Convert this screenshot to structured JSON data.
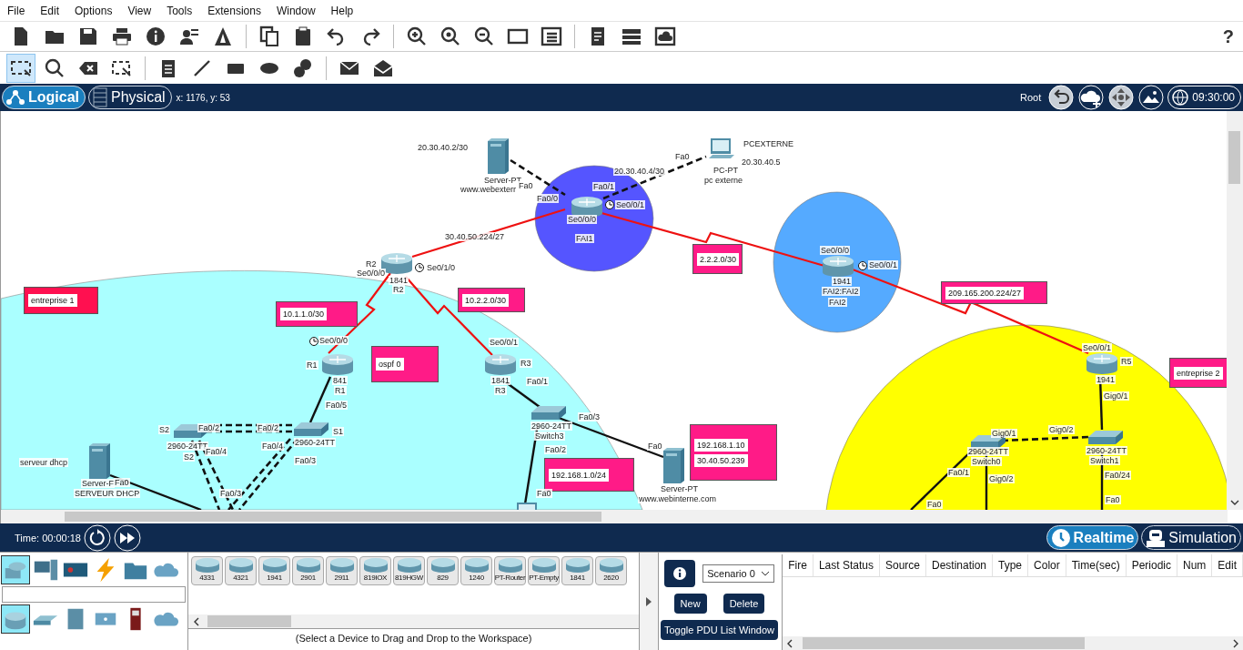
{
  "menu": [
    "File",
    "Edit",
    "Options",
    "View",
    "Tools",
    "Extensions",
    "Window",
    "Help"
  ],
  "help_glyph": "?",
  "workspace_tabs": [
    {
      "label": "Logical",
      "selected": true
    },
    {
      "label": "Physical",
      "selected": false
    }
  ],
  "cursor_position": "x: 1176, y: 53",
  "root_label": "Root",
  "clock": "09:30:00",
  "canvas": {
    "zones": [
      {
        "color": "#aaffff"
      },
      {
        "color": "#5555ff"
      },
      {
        "color": "#55aaff"
      },
      {
        "color": "#ffff00"
      }
    ],
    "notes": [
      {
        "color": "#ff1050",
        "lines": [
          "entreprise 1"
        ]
      },
      {
        "color": "#ff1b87",
        "lines": [
          "10.1.1.0/30"
        ]
      },
      {
        "color": "#ff1b87",
        "lines": [
          "10.2.2.0/30"
        ]
      },
      {
        "color": "#ff1b87",
        "lines": [
          "ospf 0"
        ]
      },
      {
        "color": "#ff1b87",
        "lines": [
          "2.2.2.0/30"
        ]
      },
      {
        "color": "#ff1b87",
        "lines": [
          "192.168.1.10",
          "30.40.50.239"
        ]
      },
      {
        "color": "#ff1b87",
        "lines": [
          "192.168.1.0/24"
        ]
      },
      {
        "color": "#ff1b87",
        "lines": [
          "209.165.200.224/27"
        ]
      },
      {
        "color": "#ff1b87",
        "lines": [
          "entreprise 2"
        ]
      }
    ],
    "devices": [
      {
        "kind": "server"
      },
      {
        "kind": "pc"
      },
      {
        "kind": "router"
      },
      {
        "kind": "router"
      },
      {
        "kind": "router"
      },
      {
        "kind": "router"
      },
      {
        "kind": "router"
      },
      {
        "kind": "router"
      },
      {
        "kind": "switch"
      },
      {
        "kind": "switch"
      },
      {
        "kind": "switch"
      },
      {
        "kind": "switch"
      },
      {
        "kind": "switch"
      },
      {
        "kind": "server"
      },
      {
        "kind": "server"
      },
      {
        "kind": "pc"
      }
    ],
    "labels": [
      "20.30.40.2/30",
      "Server-PT",
      "www.webexterr",
      "Fa0",
      "Fa0/0",
      "20.30.40.4/30",
      "Fa0",
      "PCEXTERNE",
      "20.30.40.5",
      "PC-PT",
      "pc externe",
      "Fa0/1",
      "Se0/0/1",
      "Se0/0/0",
      "FAI1",
      "30.40.50.224/27",
      "R2",
      "Se0/0/0",
      "Se0/1/0",
      "1841",
      "R2",
      "Se0/0/0",
      "Se0/0/1",
      "1941",
      "FAI2:FAI2",
      "FAI2",
      "Se0/0/0",
      "R1",
      "841",
      "R1",
      "Fa0/5",
      "Se0/0/1",
      "R3",
      "1841",
      "R3",
      "Fa0/1",
      "2960-24TT",
      "Switch3",
      "Fa0/3",
      "Fa0/2",
      "Fa0",
      "Server-PT",
      "www.webinterne.com",
      "Fa0",
      "S2",
      "Fa0/2",
      "2960-24TT",
      "S2",
      "Fa0/4",
      "Fa0/2",
      "S1",
      "Fa0/4",
      "2960-24TT",
      "Fa0/3",
      "Fa0/3",
      "serveur dhcp",
      "Server-F",
      "Fa0",
      "SERVEUR DHCP",
      "Se0/0/1",
      "R5",
      "1941",
      "Gig0/1",
      "Gig0/1",
      "Gig0/2",
      "2960-24TT",
      "Switch0",
      "Fa0/1",
      "Gig0/2",
      "2960-24TT",
      "Switch1",
      "Fa0/24",
      "Fa0",
      "Fa0"
    ]
  },
  "time": "Time: 00:00:18",
  "mode_tabs": [
    {
      "label": "Realtime",
      "selected": true
    },
    {
      "label": "Simulation",
      "selected": false
    }
  ],
  "device_categories": [
    {
      "kind": "network",
      "selected": true
    },
    {
      "kind": "end-device",
      "selected": false
    },
    {
      "kind": "component",
      "selected": false
    },
    {
      "kind": "connection",
      "selected": false
    },
    {
      "kind": "folder",
      "selected": false
    },
    {
      "kind": "cloud",
      "selected": false
    }
  ],
  "device_types": [
    {
      "kind": "router",
      "selected": true
    },
    {
      "kind": "switch",
      "selected": false
    },
    {
      "kind": "hub",
      "selected": false
    },
    {
      "kind": "wireless",
      "selected": false
    },
    {
      "kind": "security",
      "selected": false
    },
    {
      "kind": "wan",
      "selected": false
    }
  ],
  "models": [
    "4331",
    "4321",
    "1941",
    "2901",
    "2911",
    "819IOX",
    "819HGW",
    "829",
    "1240",
    "PT-Router",
    "PT-Empty",
    "1841",
    "2620"
  ],
  "hint": "(Select a Device to Drag and Drop to the Workspace)",
  "scenario": "Scenario 0",
  "buttons": [
    "New",
    "Delete"
  ],
  "toggle_button": "Toggle PDU List Window",
  "pdu_columns": [
    "Fire",
    "Last Status",
    "Source",
    "Destination",
    "Type",
    "Color",
    "Time(sec)",
    "Periodic",
    "Num",
    "Edit"
  ]
}
